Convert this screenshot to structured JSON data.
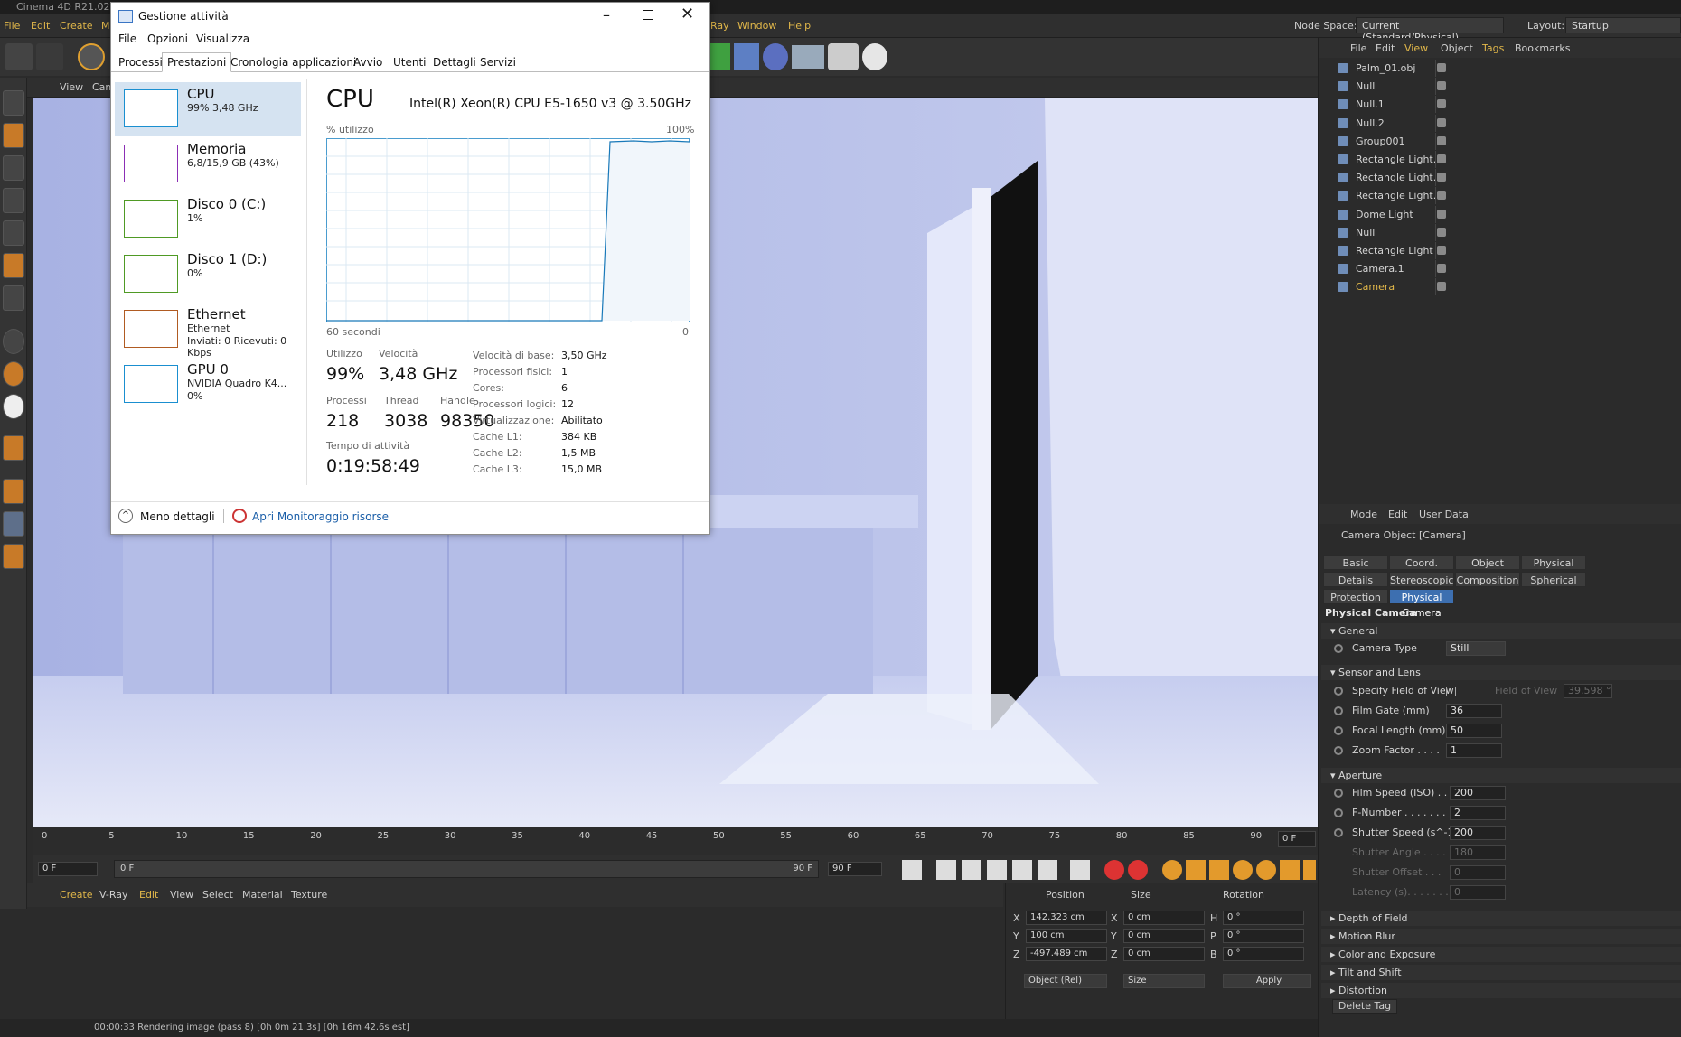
{
  "app": {
    "title": "Cinema 4D R21.022"
  },
  "menu": {
    "file": "File",
    "edit": "Edit",
    "create": "Create",
    "m": "M",
    "vray": "Ray",
    "window": "Window",
    "help": "Help",
    "node_space_label": "Node Space:",
    "node_space_value": "Current (Standard/Physical)",
    "layout_label": "Layout:",
    "layout_value": "Startup"
  },
  "viewport": {
    "view": "View",
    "cameras": "Cam"
  },
  "object_manager": {
    "menu": [
      "File",
      "Edit",
      "View",
      "Object",
      "Tags",
      "Bookmarks"
    ],
    "objects": [
      "Palm_01.obj",
      "Null",
      "Null.1",
      "Null.2",
      "Group001",
      "Rectangle Light.3",
      "Rectangle Light.2",
      "Rectangle Light.1",
      "Dome Light",
      "Null",
      "Rectangle Light",
      "Camera.1",
      "Camera"
    ]
  },
  "attributes": {
    "menu": [
      "Mode",
      "Edit",
      "User Data"
    ],
    "header": "Camera Object [Camera]",
    "tabs": [
      "Basic",
      "Coord.",
      "Object",
      "Physical",
      "Details",
      "Stereoscopic",
      "Composition",
      "Spherical",
      "Protection",
      "Physical Camera"
    ],
    "section_title": "Physical Camera",
    "general": "General",
    "camera_type_label": "Camera Type",
    "camera_type_value": "Still",
    "sensor": "Sensor and Lens",
    "specify_fov": "Specify Field of View",
    "fov_label": "Field of View",
    "fov_value": "39.598 °",
    "film_gate_label": "Film Gate (mm)",
    "film_gate_value": "36",
    "focal_label": "Focal Length (mm)",
    "focal_value": "50",
    "zoom_label": "Zoom Factor . . . .",
    "zoom_value": "1",
    "aperture": "Aperture",
    "iso_label": "Film Speed (ISO) . .",
    "iso_value": "200",
    "fnum_label": "F-Number . . . . . . .",
    "fnum_value": "2",
    "shutter_label": "Shutter Speed (s^-1)",
    "shutter_value": "200",
    "sangle_label": "Shutter Angle . . . .",
    "sangle_value": "180",
    "soffset_label": "Shutter Offset . . .",
    "soffset_value": "0",
    "latency_label": "Latency (s). . . . . . .",
    "latency_value": "0",
    "dof": "Depth of Field",
    "motion": "Motion Blur",
    "color": "Color and Exposure",
    "tilt": "Tilt and Shift",
    "distortion": "Distortion",
    "delete_tag": "Delete Tag"
  },
  "timeline": {
    "ticks": [
      "0",
      "5",
      "10",
      "15",
      "20",
      "25",
      "30",
      "35",
      "40",
      "45",
      "50",
      "55",
      "60",
      "65",
      "70",
      "75",
      "80",
      "85",
      "90"
    ],
    "current": "0 F",
    "start": "0 F",
    "start2": "0 F",
    "end": "90 F",
    "end2": "90 F"
  },
  "material_menu": [
    "Create",
    "V-Ray",
    "Edit",
    "View",
    "Select",
    "Material",
    "Texture"
  ],
  "coordinates": {
    "position": "Position",
    "size": "Size",
    "rotation": "Rotation",
    "x_pos": "142.323 cm",
    "y_pos": "100 cm",
    "z_pos": "-497.489 cm",
    "x_size": "0 cm",
    "y_size": "0 cm",
    "z_size": "0 cm",
    "h": "0 °",
    "p": "0 °",
    "b": "0 °",
    "mode": "Object (Rel)",
    "size_mode": "Size",
    "apply": "Apply"
  },
  "status": "00:00:33 Rendering image (pass 8) [0h  0m 21.3s] [0h 16m 42.6s est]",
  "taskmgr": {
    "title": "Gestione attività",
    "menu": [
      "File",
      "Opzioni",
      "Visualizza"
    ],
    "tabs": [
      "Processi",
      "Prestazioni",
      "Cronologia applicazioni",
      "Avvio",
      "Utenti",
      "Dettagli",
      "Servizi"
    ],
    "resources": [
      {
        "name": "CPU",
        "d1": "99% 3,48 GHz",
        "d2": ""
      },
      {
        "name": "Memoria",
        "d1": "6,8/15,9 GB (43%)",
        "d2": ""
      },
      {
        "name": "Disco 0 (C:)",
        "d1": "1%",
        "d2": ""
      },
      {
        "name": "Disco 1 (D:)",
        "d1": "0%",
        "d2": ""
      },
      {
        "name": "Ethernet",
        "d1": "Ethernet",
        "d2": "Inviati: 0 Ricevuti: 0 Kbps"
      },
      {
        "name": "GPU 0",
        "d1": "NVIDIA Quadro K4...",
        "d2": "0%"
      }
    ],
    "cpu_title": "CPU",
    "cpu_model": "Intel(R) Xeon(R) CPU E5-1650 v3 @ 3.50GHz",
    "util_label": "% utilizzo",
    "pct100": "100%",
    "sec60": "60 secondi",
    "zero": "0",
    "utilizzo_l": "Utilizzo",
    "utilizzo_v": "99%",
    "velocita_l": "Velocità",
    "velocita_v": "3,48 GHz",
    "processi_l": "Processi",
    "processi_v": "218",
    "thread_l": "Thread",
    "thread_v": "3038",
    "handle_l": "Handle",
    "handle_v": "98350",
    "uptime_l": "Tempo di attività",
    "uptime_v": "0:19:58:49",
    "specs": [
      [
        "Velocità di base:",
        "3,50 GHz"
      ],
      [
        "Processori fisici:",
        "1"
      ],
      [
        "Cores:",
        "6"
      ],
      [
        "Processori logici:",
        "12"
      ],
      [
        "Virtualizzazione:",
        "Abilitato"
      ],
      [
        "Cache L1:",
        "384 KB"
      ],
      [
        "Cache L2:",
        "1,5 MB"
      ],
      [
        "Cache L3:",
        "15,0 MB"
      ]
    ],
    "less": "Meno dettagli",
    "monitor": "Apri Monitoraggio risorse"
  }
}
